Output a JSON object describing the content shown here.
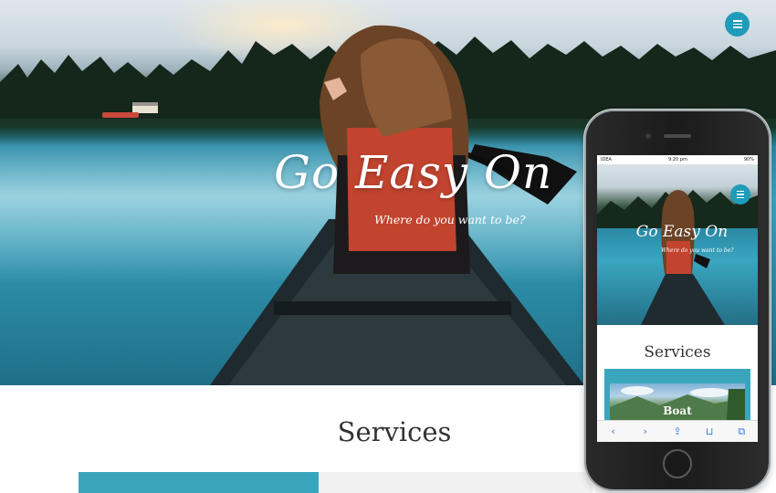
{
  "hero": {
    "title": "Go Easy On",
    "tagline": "Where do you want to be?"
  },
  "services": {
    "title": "Services"
  },
  "phone": {
    "status": {
      "carrier": "IDEA",
      "time": "9:20 pm",
      "battery": "90%"
    },
    "hero": {
      "title": "Go Easy On",
      "tagline": "Where do you want to be?"
    },
    "services_title": "Services",
    "card_label": "Boat",
    "toolbar": {
      "back_icon": "‹",
      "forward_icon": "›",
      "share_icon": "⇪",
      "bookmarks_icon": "⊔",
      "tabs_icon": "⧉"
    }
  },
  "colors": {
    "accent": "#1e9cba",
    "card": "#3aa6bd"
  },
  "icons": {
    "menu": "hamburger-menu-icon"
  }
}
